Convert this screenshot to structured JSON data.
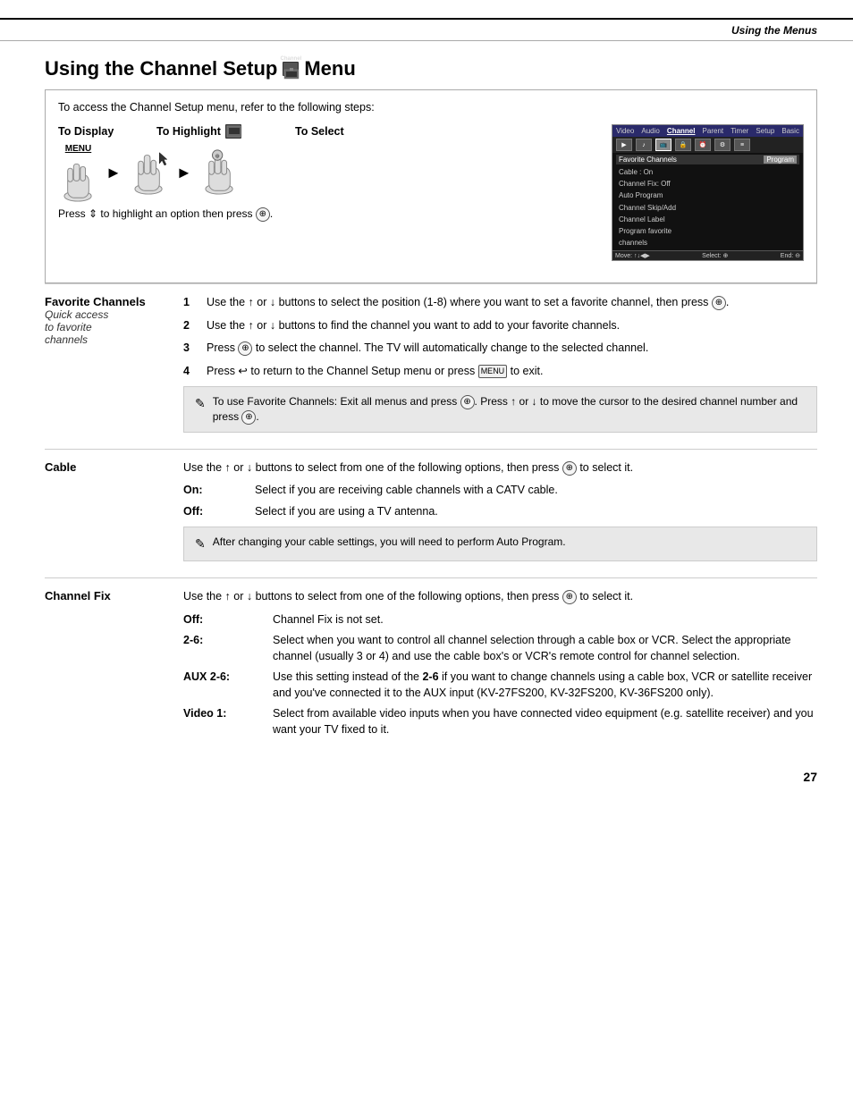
{
  "header": {
    "title": "Using the Menus"
  },
  "page": {
    "title_part1": "Using the Channel Setup",
    "title_part2": "Menu",
    "intro": "To access the Channel Setup menu, refer to the following steps:",
    "steps": {
      "display_label": "To Display",
      "highlight_label": "To Highlight",
      "select_label": "To Select",
      "press_instruction": "Press ↕ to highlight an option then press ⊕."
    },
    "menu_screenshot": {
      "tabs": [
        "Video",
        "Audio",
        "Channel",
        "Parent",
        "Timer",
        "Setup",
        "Basic"
      ],
      "active_tab": "Channel",
      "section_header": "Favorite Channels",
      "program_btn": "Program",
      "items": [
        "Cable : On",
        "Channel Fix: Off",
        "Auto Program",
        "Channel Skip/Add",
        "Channel Label",
        "Program favorite",
        "channels"
      ],
      "bottom": "Move: ↑↓◀▶   Select: ⊕   End: ⊖"
    }
  },
  "sections": {
    "favorite_channels": {
      "title": "Favorite Channels",
      "subtitle": "Quick access to favorite channels",
      "steps": [
        {
          "num": "1",
          "text": "Use the ↑ or ↓ buttons to select the position (1-8) where you want to set a favorite channel, then press ⊕."
        },
        {
          "num": "2",
          "text": "Use the ↑ or ↓ buttons to find the channel you want to add to your favorite channels."
        },
        {
          "num": "3",
          "text": "Press ⊕ to select the channel. The TV will automatically change to the selected channel."
        },
        {
          "num": "4",
          "text": "Press ← to return to the Channel Setup menu or press MENU to exit."
        }
      ],
      "note": "To use Favorite Channels: Exit all menus and press ⊕. Press ↑ or ↓ to move the cursor to the desired channel number and press ⊕."
    },
    "cable": {
      "title": "Cable",
      "desc": "Use the ↑ or ↓ buttons to select from one of the following options, then press ⊕ to select it.",
      "note": "After changing your cable settings, you will need to perform Auto Program.",
      "terms": [
        {
          "term": "On:",
          "def": "Select if you are receiving cable channels with a CATV cable."
        },
        {
          "term": "Off:",
          "def": "Select if you are using a TV antenna."
        }
      ]
    },
    "channel_fix": {
      "title": "Channel Fix",
      "desc": "Use the ↑ or ↓ buttons to select from one of the following options, then press ⊕ to select it.",
      "terms": [
        {
          "term": "Off:",
          "def": "Channel Fix is not set."
        },
        {
          "term": "2-6:",
          "def": "Select when you want to control all channel selection through a cable box or VCR. Select the appropriate channel (usually 3 or 4) and use the cable box's or VCR's remote control for channel selection."
        },
        {
          "term": "AUX 2-6:",
          "def": "Use this setting instead of the 2-6 if you want to change channels using a cable box, VCR or satellite receiver and you've connected it to the AUX input (KV-27FS200, KV-32FS200, KV-36FS200 only)."
        },
        {
          "term": "Video 1:",
          "def": "Select from available video inputs when you have connected video equipment (e.g. satellite receiver) and you want your TV fixed to it."
        }
      ]
    }
  },
  "page_number": "27"
}
